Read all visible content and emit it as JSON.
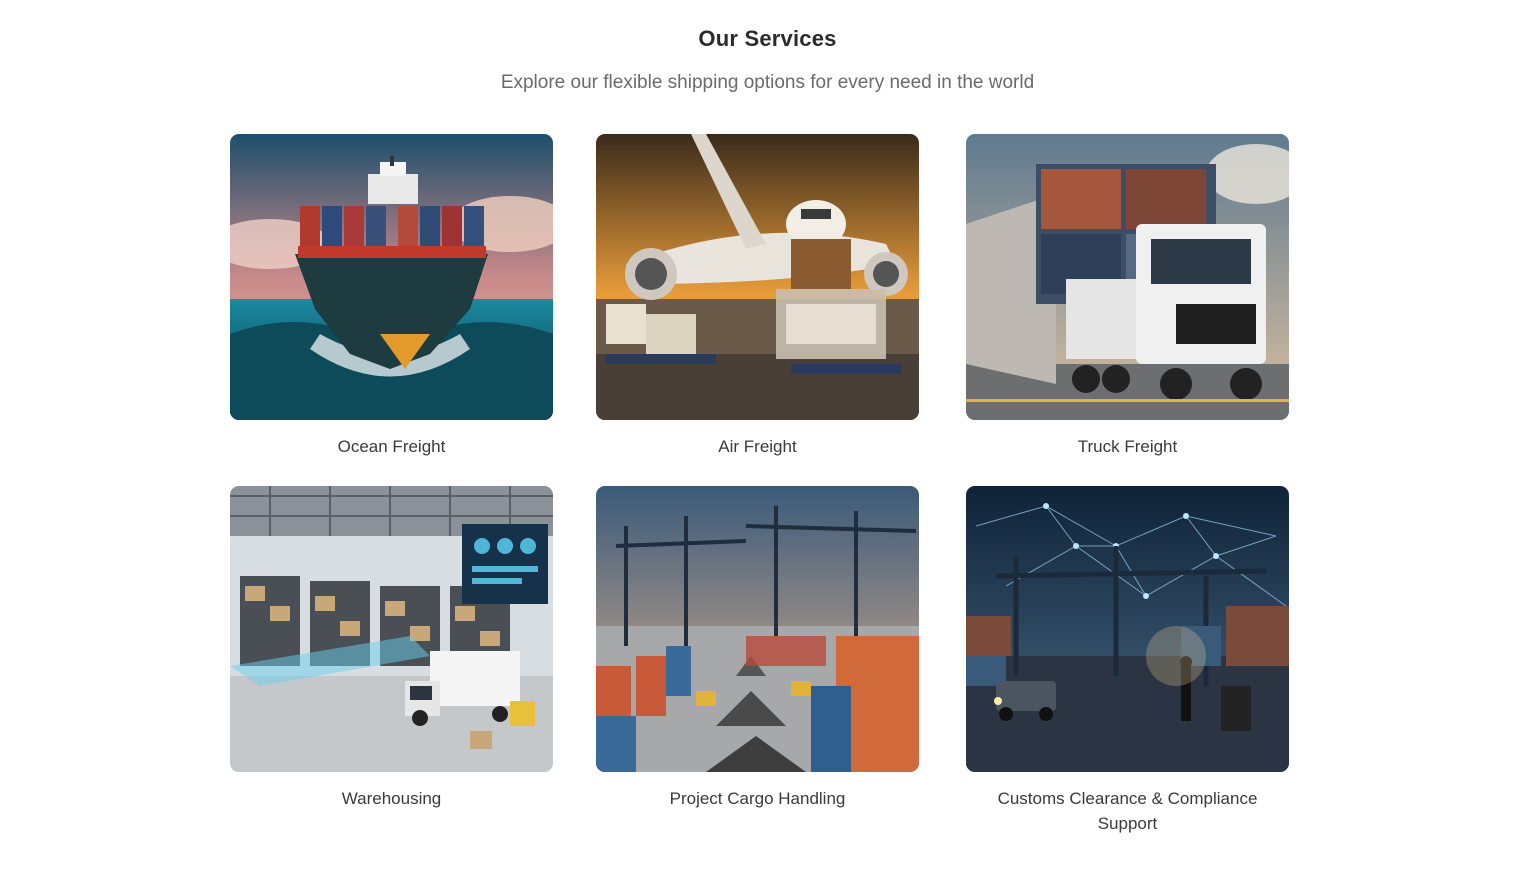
{
  "section": {
    "title": "Our Services",
    "subtitle": "Explore our flexible shipping options for every need in the world"
  },
  "services": [
    {
      "label": "Ocean Freight",
      "icon": "container-ship-image"
    },
    {
      "label": "Air Freight",
      "icon": "cargo-plane-image"
    },
    {
      "label": "Truck Freight",
      "icon": "truck-image"
    },
    {
      "label": "Warehousing",
      "icon": "warehouse-image"
    },
    {
      "label": "Project Cargo Handling",
      "icon": "port-cranes-image"
    },
    {
      "label": "Customs Clearance & Compliance Support",
      "icon": "digital-port-image"
    }
  ],
  "colors": {
    "text_dark": "#2b2b2b",
    "text_muted": "#6b6b6b",
    "background": "#ffffff"
  }
}
